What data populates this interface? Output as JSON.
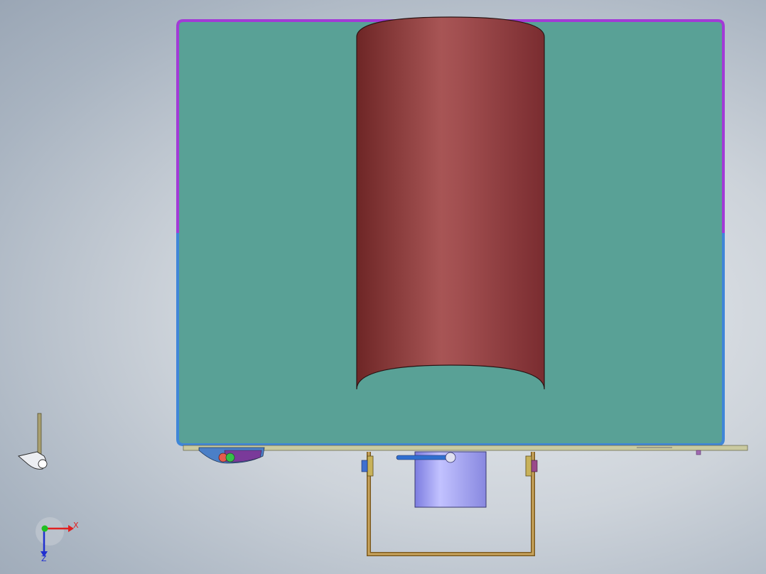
{
  "viewport": {
    "background_colors": [
      "#e9ecef",
      "#cdd3da",
      "#a9b4c1"
    ]
  },
  "model": {
    "colors": {
      "panel_fill": "#59a196",
      "frame_top": "#a23bd6",
      "frame_bottom": "#3f86d8",
      "cylinder_dark": "#7a2c2c",
      "cylinder_light": "#a85555",
      "cylinder_base": "#8c3a3c",
      "bracket": "#b9904a",
      "block": "#8f8fe8",
      "block_light": "#c2c2ff",
      "rod": "#2f6fd0",
      "rail": "#c9c9a0"
    }
  },
  "triad": {
    "x_label": "X",
    "z_label": "Z",
    "x_color": "#e02020",
    "y_color": "#20c020",
    "z_color": "#2030d0"
  }
}
